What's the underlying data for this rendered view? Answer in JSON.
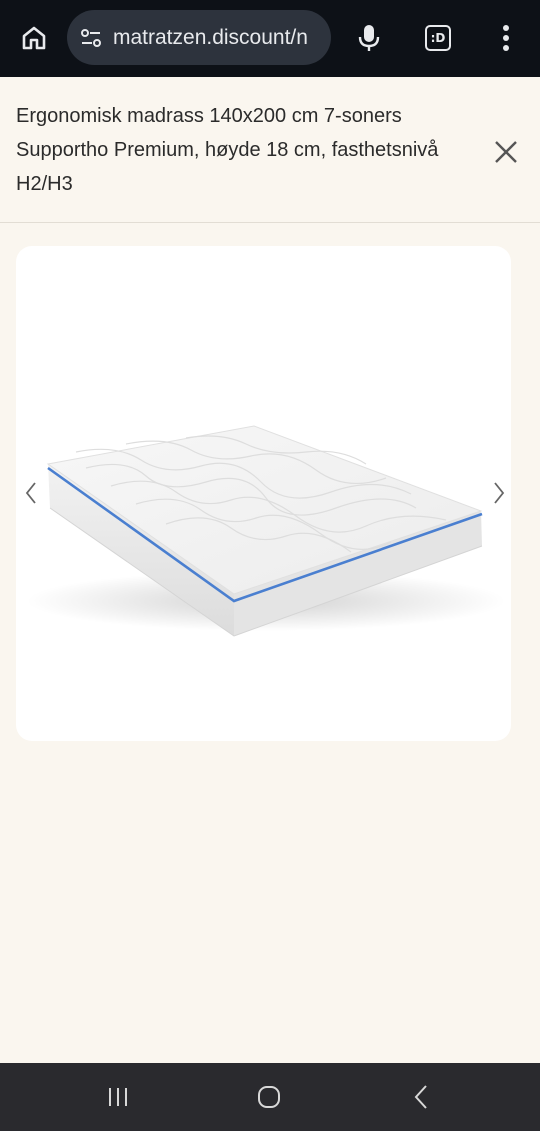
{
  "browser": {
    "url": "matratzen.discount/n",
    "icons": {
      "home": "home-icon",
      "site_info": "site-settings-icon",
      "voice": "microphone-icon",
      "tabs": "tab-switcher-icon",
      "menu": "overflow-menu-icon"
    },
    "tab_badge": ":D"
  },
  "product": {
    "title": "Ergonomisk madrass 140x200 cm 7-soners Supportho Premium, høyde 18 cm, fasthetsnivå H2/H3",
    "close_icon": "close-icon"
  },
  "gallery": {
    "image": "mattress-image",
    "prev_icon": "chevron-left-icon",
    "next_icon": "chevron-right-icon"
  },
  "system_nav": {
    "recents_icon": "recent-apps-icon",
    "home_icon": "home-circle-icon",
    "back_icon": "back-icon"
  },
  "colors": {
    "browser_bar": "#0d1117",
    "url_pill": "#2d333d",
    "page_bg": "#faf6ef",
    "zipper_blue": "#4a7fd0"
  }
}
